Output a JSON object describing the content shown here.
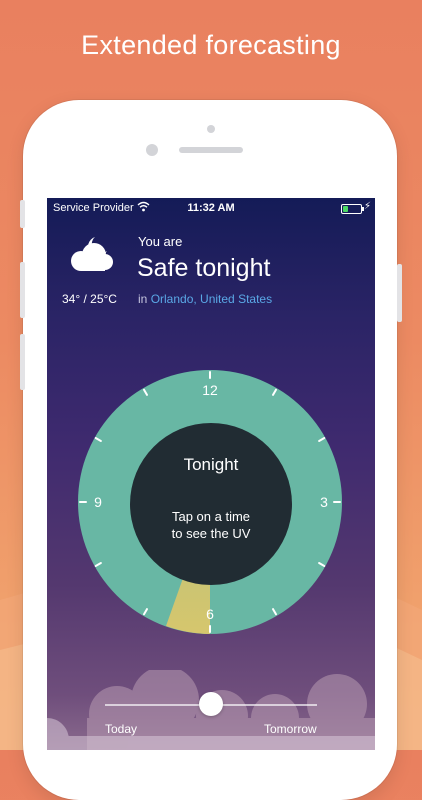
{
  "headline": "Extended forecasting",
  "status_bar": {
    "carrier": "Service Provider",
    "time": "11:32 AM"
  },
  "header": {
    "weather_icon": "moon-cloud-icon",
    "temperature": "34° / 25°C",
    "intro": "You are",
    "status": "Safe tonight",
    "location_prefix": "in",
    "location": "Orlando, United States"
  },
  "dial": {
    "center_title": "Tonight",
    "center_hint_line1": "Tap on a time",
    "center_hint_line2": "to see the UV",
    "hour_labels": [
      "12",
      "3",
      "6",
      "9"
    ],
    "ring_color": "#68b7a4",
    "center_color": "#212c33",
    "highlight_color": "#d6c66d"
  },
  "slider": {
    "left_label": "Today",
    "right_label": "Tomorrow",
    "value": 0.5
  }
}
